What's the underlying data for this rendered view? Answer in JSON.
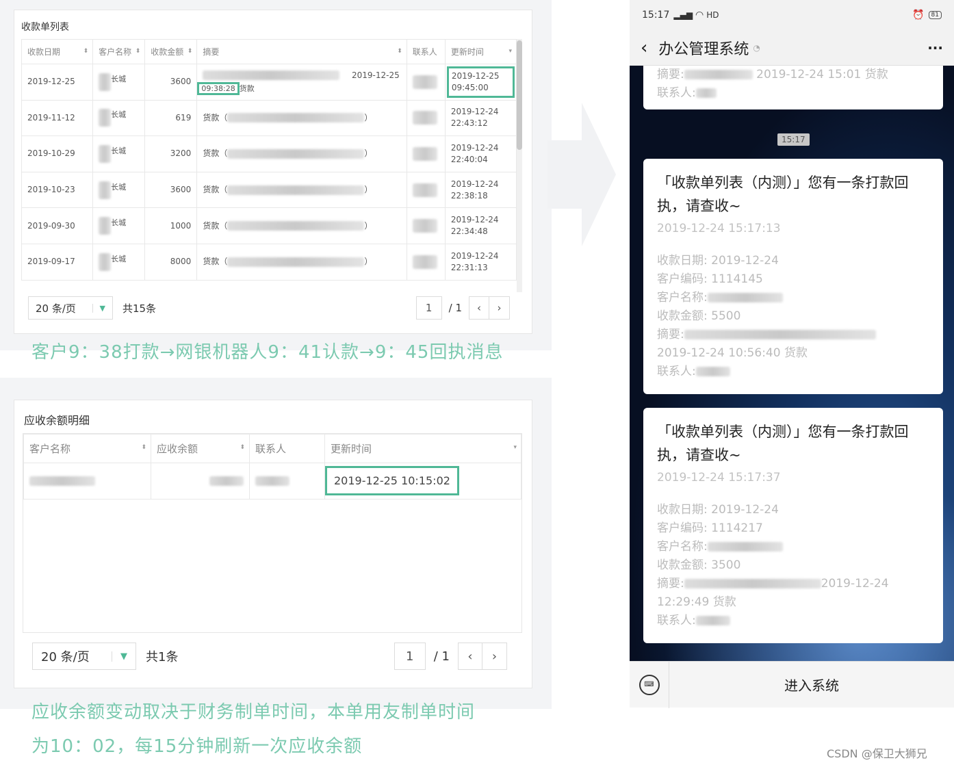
{
  "receipt_list": {
    "title": "收款单列表",
    "headers": [
      "收款日期",
      "客户名称",
      "收款金额",
      "摘要",
      "联系人",
      "更新时间"
    ],
    "rows": [
      {
        "date": "2019-12-25",
        "cust": "长城",
        "amount": "3600",
        "sum_pre": "",
        "sum_date": "2019-12-25",
        "sum_time": "09:38:28",
        "sum_post": "货款",
        "upd1": "2019-12-25",
        "upd2": "09:45:00"
      },
      {
        "date": "2019-11-12",
        "cust": "长城",
        "amount": "619",
        "sum_pre": "货款（",
        "sum_post": "）",
        "upd1": "2019-12-24",
        "upd2": "22:43:12"
      },
      {
        "date": "2019-10-29",
        "cust": "长城",
        "amount": "3200",
        "sum_pre": "货款（",
        "sum_post": "）",
        "upd1": "2019-12-24",
        "upd2": "22:40:04"
      },
      {
        "date": "2019-10-23",
        "cust": "长城",
        "amount": "3600",
        "sum_pre": "货款（",
        "sum_post": "）",
        "upd1": "2019-12-24",
        "upd2": "22:38:18"
      },
      {
        "date": "2019-09-30",
        "cust": "长城",
        "amount": "1000",
        "sum_pre": "货款（",
        "sum_post": "）",
        "upd1": "2019-12-24",
        "upd2": "22:34:48"
      },
      {
        "date": "2019-09-17",
        "cust": "长城",
        "amount": "8000",
        "sum_pre": "货款（",
        "sum_post": "）",
        "upd1": "2019-12-24",
        "upd2": "22:31:13"
      }
    ],
    "page_size": "20 条/页",
    "total": "共15条",
    "page": "1",
    "pages": "/ 1"
  },
  "caption1": "客户9：38打款→网银机器人9：41认款→9：45回执消息",
  "balance": {
    "title": "应收余额明细",
    "headers": [
      "客户名称",
      "应收余额",
      "联系人",
      "更新时间"
    ],
    "row_time": "2019-12-25 10:15:02",
    "page_size": "20 条/页",
    "total": "共1条",
    "page": "1",
    "pages": "/ 1"
  },
  "caption2_line1": "应收余额变动取决于财务制单时间，本单用友制单时间",
  "caption2_line2": "为10：02，每15分钟刷新一次应收余额",
  "phone": {
    "status_time": "15:17",
    "status_net": "HD",
    "battery": "81",
    "title": "办公管理系统",
    "more": "···",
    "top_summary_label": "摘要:",
    "top_summary_tail": "2019-12-24 15:01 货款",
    "top_contact": "联系人:",
    "time_divider": "15:17",
    "msg1": {
      "title": "「收款单列表（内测）」您有一条打款回执，请查收~",
      "time": "2019-12-24 15:17:13",
      "date": "收款日期: 2019-12-24",
      "code": "客户编码: 1114145",
      "name": "客户名称:",
      "amount": "收款金额: 5500",
      "summary": "摘要:",
      "summary2": "2019-12-24 10:56:40 货款",
      "contact": "联系人:"
    },
    "msg2": {
      "title": "「收款单列表（内测）」您有一条打款回执，请查收~",
      "time": "2019-12-24 15:17:37",
      "date": "收款日期: 2019-12-24",
      "code": "客户编码: 1114217",
      "name": "客户名称:",
      "amount": "收款金额: 3500",
      "summary": "摘要:",
      "summary_tail": "2019-12-24",
      "summary2": "12:29:49 货款",
      "contact": "联系人:"
    },
    "enter_system": "进入系统"
  },
  "watermark": "CSDN @保卫大狮兄",
  "colors": {
    "accent": "#4fb896",
    "caption": "#7ccab0",
    "phone_bg": "#0d1a33"
  }
}
